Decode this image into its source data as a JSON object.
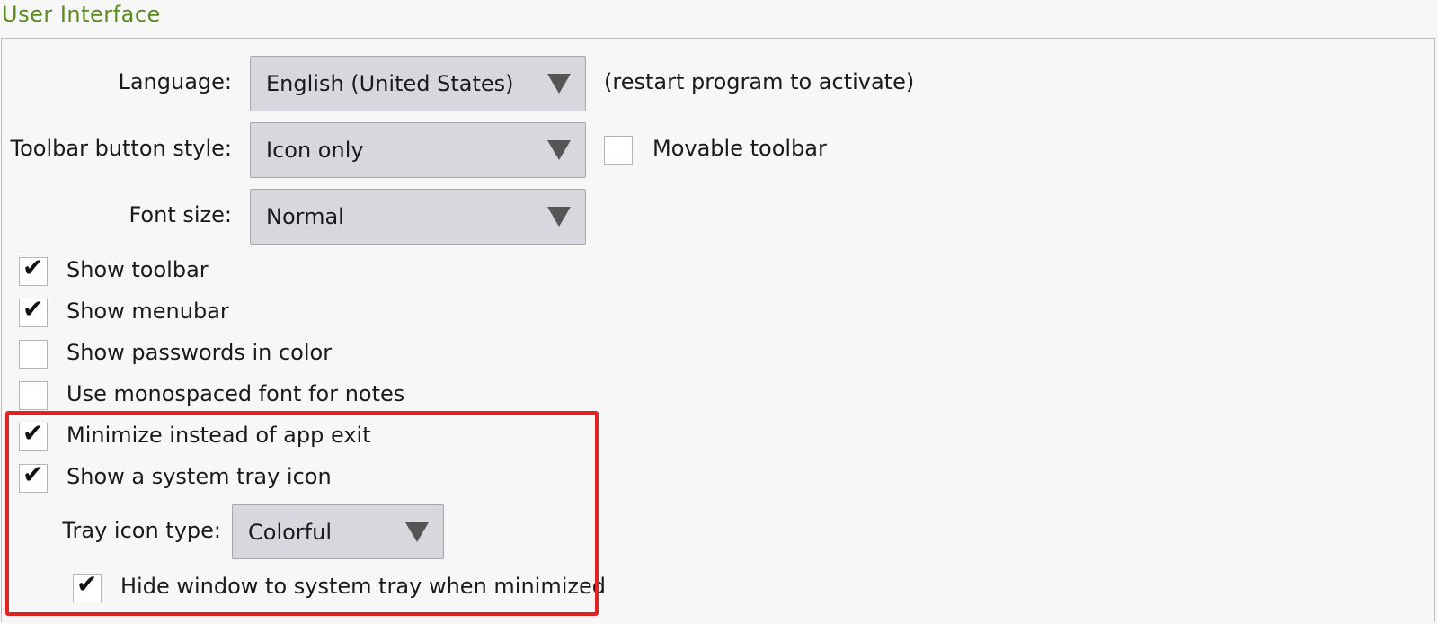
{
  "group": {
    "title": "User Interface"
  },
  "language": {
    "label": "Language:",
    "value": "English (United States)",
    "note": "(restart program to activate)"
  },
  "toolbar_style": {
    "label": "Toolbar button style:",
    "value": "Icon only"
  },
  "movable_toolbar": {
    "label": "Movable toolbar",
    "checked": false
  },
  "font_size": {
    "label": "Font size:",
    "value": "Normal"
  },
  "checkboxes": {
    "show_toolbar": {
      "label": "Show toolbar",
      "checked": true
    },
    "show_menubar": {
      "label": "Show menubar",
      "checked": true
    },
    "show_passwords_color": {
      "label": "Show passwords in color",
      "checked": false
    },
    "monospaced_notes": {
      "label": "Use monospaced font for notes",
      "checked": false
    },
    "minimize_instead_exit": {
      "label": "Minimize instead of app exit",
      "checked": true
    },
    "show_tray_icon": {
      "label": "Show a system tray icon",
      "checked": true
    },
    "hide_to_tray": {
      "label": "Hide window to system tray when minimized",
      "checked": true
    }
  },
  "tray_icon_type": {
    "label": "Tray icon type:",
    "value": "Colorful"
  },
  "icons": {
    "check": "✔",
    "dropdown": "dropdown-arrow-icon"
  },
  "colors": {
    "title": "#5a8a1e",
    "highlight": "#e02424"
  }
}
